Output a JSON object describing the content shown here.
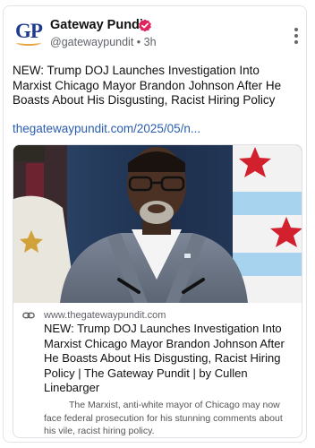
{
  "author": {
    "avatar_text": "GP",
    "name": "Gateway Pundit",
    "handle": "@gatewaypundit",
    "separator": "•",
    "time": "3h",
    "verified_icon": "verified-badge-icon",
    "brand_color": "#1f3c8c",
    "badge_color": "#e0245e"
  },
  "post": {
    "text": "NEW: Trump DOJ Launches Investigation Into Marxist Chicago Mayor Brandon Johnson After He Boasts About His Disgusting, Racist Hiring Policy",
    "link": "thegatewaypundit.com/2025/05/n..."
  },
  "card": {
    "domain": "www.thegatewaypundit.com",
    "title": "NEW: Trump DOJ Launches Investigation Into Marxist Chicago Mayor Brandon Johnson After He Boasts About His Disgusting, Racist Hiring Policy | The Gateway Pundit | by Cullen Linebarger",
    "description": "The Marxist, anti-white mayor of Chicago may now face federal prosecution for his stunning comments about his vile, racist hiring policy.",
    "link_icon": "link-icon"
  },
  "menu_icon": "more-options-icon"
}
